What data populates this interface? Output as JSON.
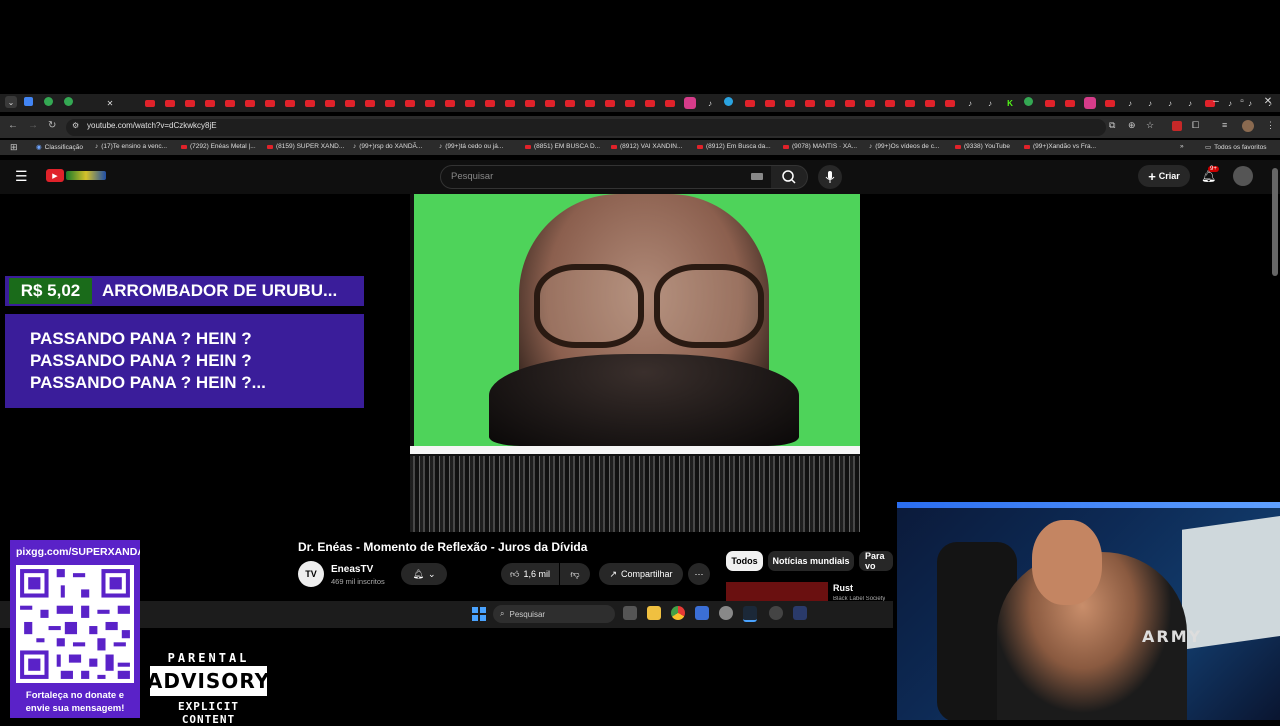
{
  "browser": {
    "url": "youtube.com/watch?v=dCzkwkcy8jE",
    "bookmarks": [
      "Classificação",
      "(17)Te ensino a venc...",
      "(7292) Enéas Metal |...",
      "(8159) SUPER XAND...",
      "(99+)rsp do XANDÃ...",
      "(99+)tá cedo ou já...",
      "(8851) EM BUSCA D...",
      "(8912) VAI XANDIN...",
      "(8912) Em Busca da...",
      "(9078) MANTIS · XA...",
      "(99+)Os vídeos de c...",
      "(9338) YouTube",
      "(99+)Xandão vs Fra..."
    ],
    "all_bookmarks": "Todos os favoritos"
  },
  "youtube": {
    "search_placeholder": "Pesquisar",
    "create_label": "Criar",
    "notification_badge": "9+",
    "video_title": "Dr. Enéas - Momento de Reflexão - Juros da Dívida",
    "channel_name": "EneasTV",
    "channel_subs": "469 mil inscritos",
    "likes": "1,6 mil",
    "share_label": "Compartilhar",
    "chips": [
      "Todos",
      "Notícias mundiais",
      "Para vo"
    ],
    "rec_title": "Rust",
    "rec_channel": "Black Label Society"
  },
  "donation": {
    "amount": "R$ 5,02",
    "donor": "ARROMBADOR DE URUBU...",
    "message_lines": [
      "PASSANDO PANA ? HEIN ?",
      "PASSANDO PANA ? HEIN ?",
      "PASSANDO PANA ? HEIN ?..."
    ]
  },
  "pix": {
    "url": "pixgg.com/SUPERXANDA",
    "cta_line1": "Fortaleça no donate e",
    "cta_line2": "envie sua mensagem!"
  },
  "advisory": {
    "top": "PARENTAL",
    "mid": "ADVISORY",
    "bot": "EXPLICIT CONTENT"
  },
  "taskbar": {
    "search_label": "Pesquisar"
  },
  "webcam": {
    "shirt_text": "ARMY"
  },
  "colors": {
    "youtube_red": "#e0222a",
    "donation_purple": "#3a1d9a",
    "donation_green": "#1a6b1a",
    "pix_purple": "#5a22c8"
  }
}
